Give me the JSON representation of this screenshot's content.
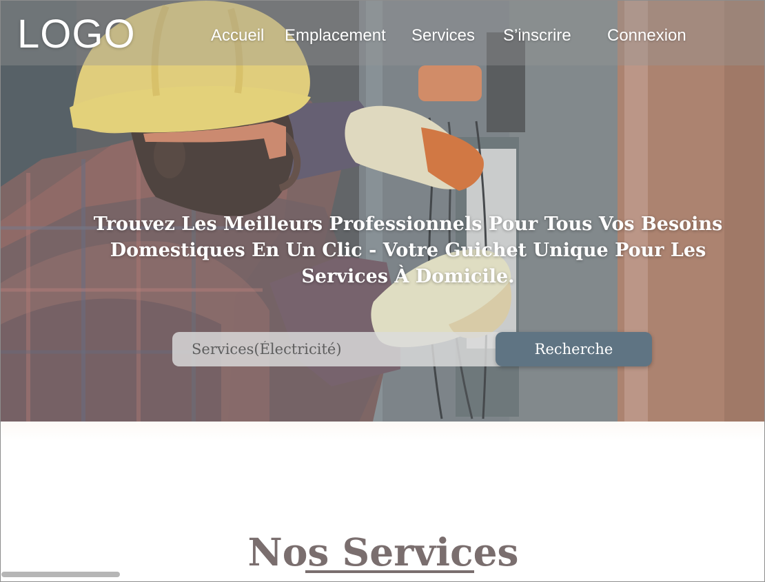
{
  "header": {
    "logo": "LOGO",
    "nav": [
      {
        "label": "Accueil"
      },
      {
        "label": "Emplacement"
      },
      {
        "label": "Services"
      },
      {
        "label": "S’inscrire"
      },
      {
        "label": "Connexion"
      }
    ]
  },
  "hero": {
    "title": "Trouvez Les Meilleurs Professionnels Pour Tous Vos Besoins Domestiques En Un Clic - Votre Guichet Unique Pour Les Services À Domicile.",
    "search": {
      "placeholder": "Services(Électricité)",
      "button_label": "Recherche"
    }
  },
  "services_section": {
    "title": "Nos Services"
  },
  "colors": {
    "button_bg": "#5f7483",
    "heading_text": "#7a6e6e",
    "hero_text": "#ffffff"
  }
}
